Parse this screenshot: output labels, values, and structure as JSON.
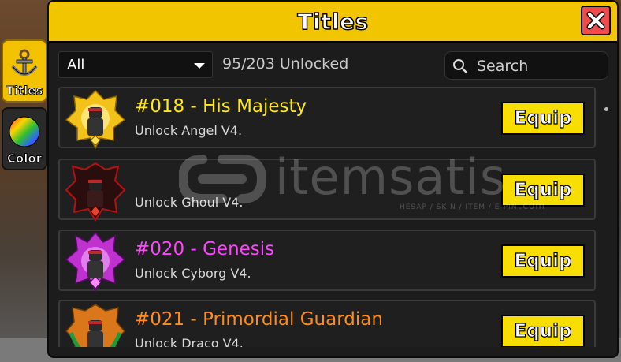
{
  "window": {
    "title": "Titles"
  },
  "side_tabs": [
    {
      "label": "Titles",
      "icon": "anchor-icon",
      "active": true
    },
    {
      "label": "Color",
      "icon": "color-wheel-icon",
      "active": false
    }
  ],
  "filter": {
    "selected": "All"
  },
  "unlock_count": "95/203 Unlocked",
  "search": {
    "placeholder": "Search"
  },
  "titles": [
    {
      "title": "#018 - His Majesty",
      "description": "Unlock Angel V4.",
      "color": "#ffe81a",
      "badge": "gold",
      "button": "Equip"
    },
    {
      "title": "",
      "description": "Unlock Ghoul V4.",
      "color": "#ff3b3b",
      "badge": "dark-red",
      "button": "Equip"
    },
    {
      "title": "#020 - Genesis",
      "description": "Unlock Cyborg V4.",
      "color": "#ff44ff",
      "badge": "magenta",
      "button": "Equip"
    },
    {
      "title": "#021 - Primordial Guardian",
      "description": "Unlock Draco V4.",
      "color": "#ff8c1a",
      "badge": "orange-green",
      "button": "Equip"
    }
  ],
  "watermark": {
    "brand": "itemsatis",
    "tagline": "HESAP / SKIN / ITEM / E-PIN",
    "domain": ".com"
  },
  "colors": {
    "accent": "#f1c600",
    "close": "#f24b4b",
    "equip": "#f8de00",
    "panel": "#1c1c1c"
  }
}
